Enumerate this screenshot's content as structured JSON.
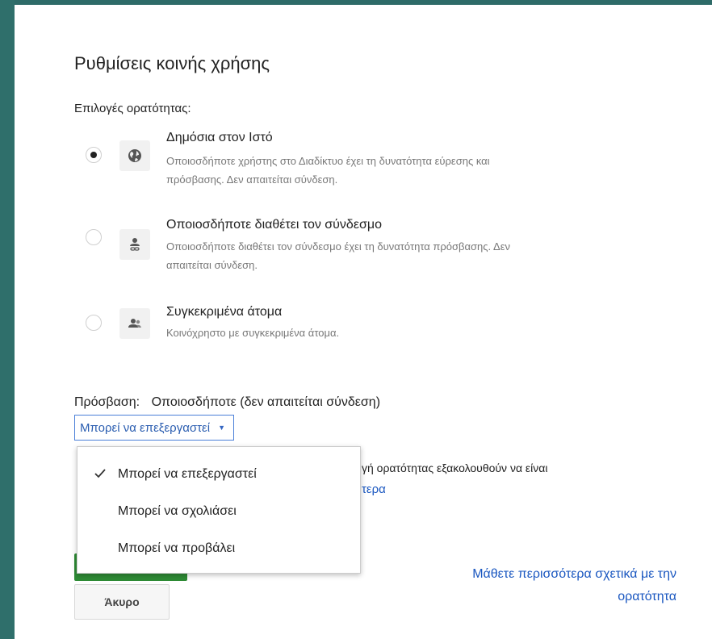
{
  "dialog": {
    "title": "Ρυθμίσεις κοινής χρήσης",
    "visibility_label": "Επιλογές ορατότητας:",
    "options": [
      {
        "title": "Δημόσια στον Ιστό",
        "desc_line1": "Οποιοσδήποτε χρήστης στο Διαδίκτυο έχει τη δυνατότητα εύρεσης και",
        "desc_line2": "πρόσβασης. Δεν απαιτείται σύνδεση.",
        "icon": "globe-icon",
        "selected": true
      },
      {
        "title": "Οποιοσδήποτε διαθέτει τον σύνδεσμο",
        "desc_line1": "Οποιοσδήποτε διαθέτει τον σύνδεσμο έχει τη δυνατότητα πρόσβασης. Δεν",
        "desc_line2": "απαιτείται σύνδεση.",
        "icon": "person-link-icon",
        "selected": false
      },
      {
        "title": "Συγκεκριμένα άτομα",
        "desc_line1": "Κοινόχρηστο με συγκεκριμένα άτομα.",
        "icon": "people-icon",
        "selected": false
      }
    ],
    "access_label": "Πρόσβαση:",
    "access_value": "Οποιοσδήποτε (δεν απαιτείται σύνδεση)",
    "permission_dropdown": "Μπορεί να επεξεργαστεί",
    "bg_text_partial": "γή ορατότητας εξακολουθούν να είναι",
    "bg_link_partial": "τερα",
    "cancel_button": "Άκυρο",
    "learn_more_line1": "Μάθετε περισσότερα σχετικά με την",
    "learn_more_line2": "ορατότητα"
  },
  "menu": {
    "items": [
      {
        "label": "Μπορεί να επεξεργαστεί",
        "checked": true
      },
      {
        "label": "Μπορεί να σχολιάσει",
        "checked": false
      },
      {
        "label": "Μπορεί να προβάλει",
        "checked": false
      }
    ]
  },
  "colors": {
    "background": "#2f6f6b",
    "link": "#1a57c0",
    "primary_button": "#2e8b35"
  }
}
